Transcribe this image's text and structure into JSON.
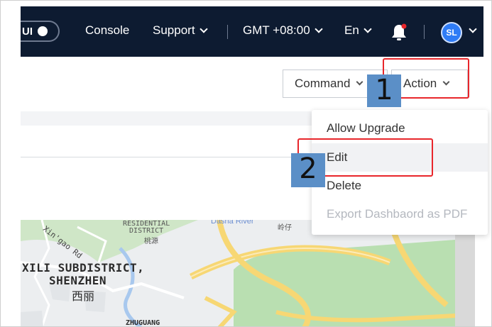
{
  "topbar": {
    "ui_toggle_label": "UI",
    "console": "Console",
    "support": "Support",
    "timezone": "GMT +08:00",
    "language": "En",
    "avatar_initials": "SL"
  },
  "toolbar": {
    "command_label": "Command",
    "action_label": "Action"
  },
  "action_menu": {
    "items": [
      {
        "label": "Allow Upgrade"
      },
      {
        "label": "Edit"
      },
      {
        "label": "Delete"
      },
      {
        "label": "Export Dashbaord as PDF"
      }
    ]
  },
  "map": {
    "labels": {
      "xingao_rd": "Xin'gao Rd",
      "residential_district": "RESIDENTIAL\nDISTRICT",
      "residential_cn": "桃源",
      "dasha_river": "Dasha River",
      "lingzai": "岭仔",
      "xili_line1": "XILI SUBDISTRICT,",
      "xili_line2": "SHENZHEN",
      "xili_cn": "西丽",
      "zhuguang": "ZHUGUANG"
    }
  },
  "annotations": {
    "step1": "1",
    "step2": "2"
  },
  "colors": {
    "nav_bg": "#0d1b31",
    "highlight_red": "#e8262b",
    "badge_blue": "#5b8fc7",
    "map_green": "#b9dfb1",
    "map_road": "#f7d774"
  }
}
